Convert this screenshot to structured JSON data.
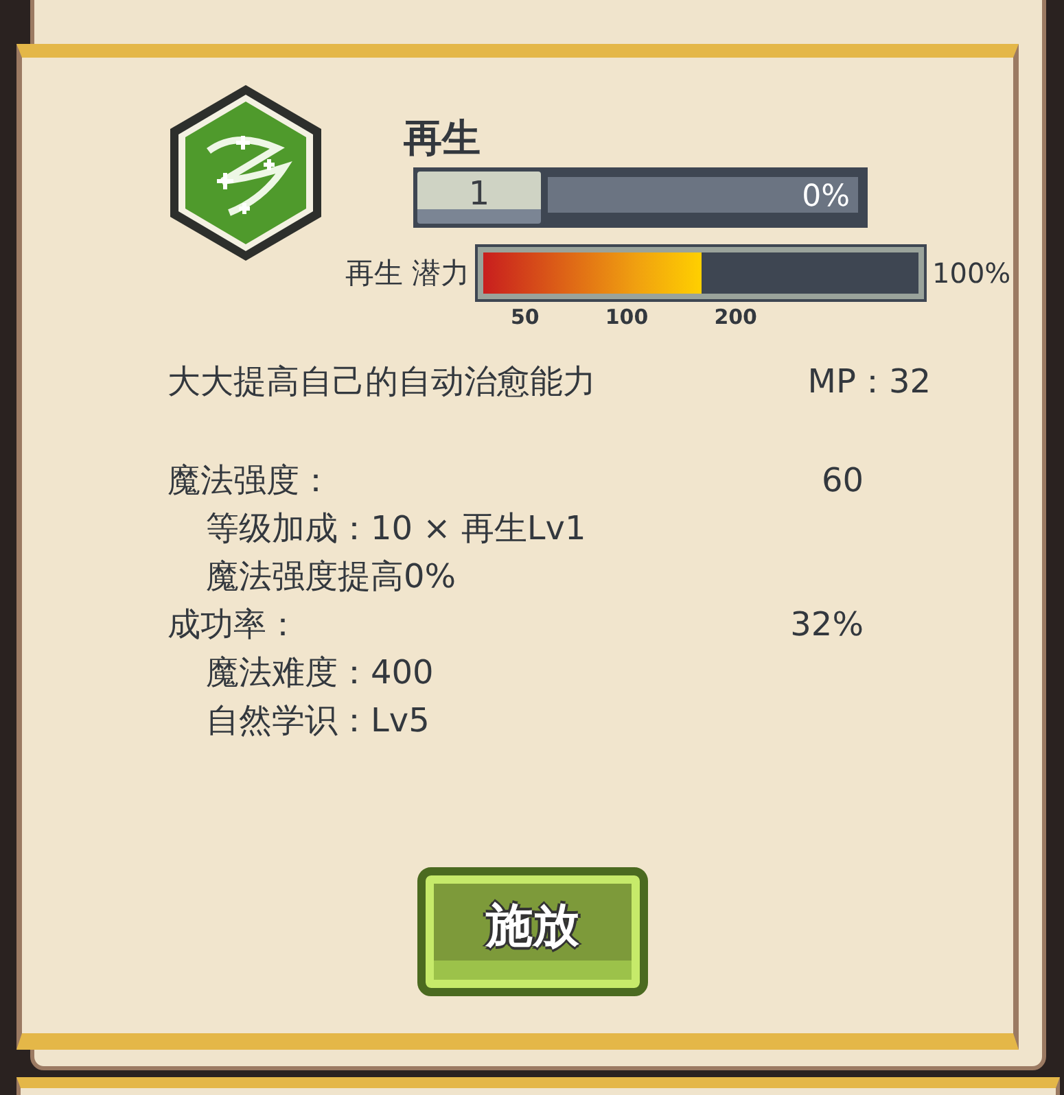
{
  "skill": {
    "name": "再生",
    "rank": "1",
    "progress": {
      "level": 0,
      "reading": "0%"
    }
  },
  "potential": {
    "label": "再生 潜力",
    "level": 0.5,
    "reading": "100%",
    "ticks": [
      "50",
      "100",
      "200"
    ]
  },
  "description": {
    "text": "大大提高自己的自动治愈能力",
    "cost": "MP：32"
  },
  "stats": [
    {
      "kind": "header",
      "label": "魔法强度：",
      "value": "60"
    },
    {
      "kind": "detail",
      "label": "等级加成：10 × 再生Lv1"
    },
    {
      "kind": "detail",
      "label": "魔法强度提高0%"
    },
    {
      "kind": "header",
      "label": "成功率：",
      "value": "32%"
    },
    {
      "kind": "detail",
      "label": "魔法难度：400"
    },
    {
      "kind": "detail",
      "label": "自然学识：Lv5"
    }
  ],
  "button": {
    "label": "施放"
  }
}
